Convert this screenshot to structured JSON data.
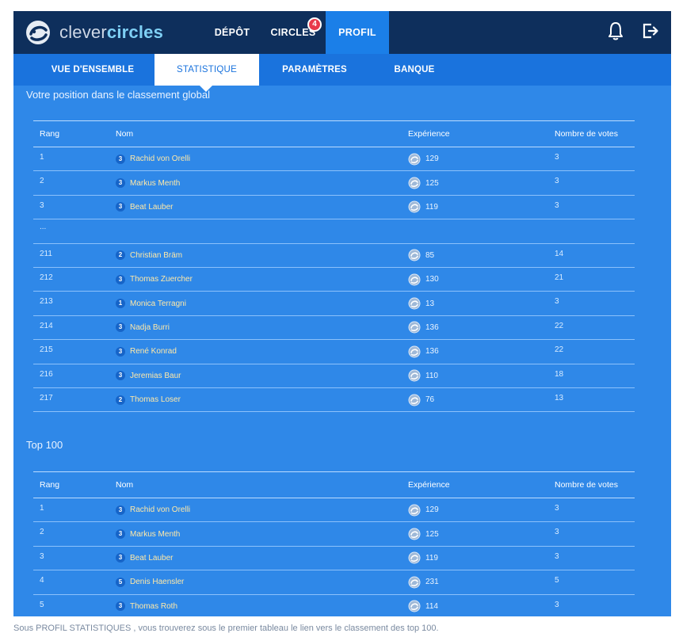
{
  "brand": {
    "light": "clever",
    "bold": "circles"
  },
  "nav": {
    "depot": "DÉPÔT",
    "circles": "CIRCLES",
    "circles_badge": "4",
    "profil": "PROFIL"
  },
  "subnav": {
    "vue": "VUE D'ENSEMBLE",
    "stat": "STATISTIQUE",
    "param": "PARAMÈTRES",
    "banque": "BANQUE"
  },
  "global": {
    "title": "Votre position dans le classement global",
    "headers": {
      "rank": "Rang",
      "name": "Nom",
      "exp": "Expérience",
      "votes": "Nombre de votes"
    },
    "rows_top": [
      {
        "rank": "1",
        "level": "3",
        "name": "Rachid von Orelli",
        "exp": "129",
        "votes": "3"
      },
      {
        "rank": "2",
        "level": "3",
        "name": "Markus Menth",
        "exp": "125",
        "votes": "3"
      },
      {
        "rank": "3",
        "level": "3",
        "name": "Beat Lauber",
        "exp": "119",
        "votes": "3"
      }
    ],
    "ellipsis": "...",
    "rows_bottom": [
      {
        "rank": "211",
        "level": "2",
        "name": "Christian Bräm",
        "exp": "85",
        "votes": "14"
      },
      {
        "rank": "212",
        "level": "3",
        "name": "Thomas Zuercher",
        "exp": "130",
        "votes": "21"
      },
      {
        "rank": "213",
        "level": "1",
        "name": "Monica Terragni",
        "exp": "13",
        "votes": "3"
      },
      {
        "rank": "214",
        "level": "3",
        "name": "Nadja Burri",
        "exp": "136",
        "votes": "22"
      },
      {
        "rank": "215",
        "level": "3",
        "name": "René Konrad",
        "exp": "136",
        "votes": "22"
      },
      {
        "rank": "216",
        "level": "3",
        "name": "Jeremias Baur",
        "exp": "110",
        "votes": "18"
      },
      {
        "rank": "217",
        "level": "2",
        "name": "Thomas Loser",
        "exp": "76",
        "votes": "13"
      }
    ]
  },
  "top100": {
    "title": "Top 100",
    "headers": {
      "rank": "Rang",
      "name": "Nom",
      "exp": "Expérience",
      "votes": "Nombre de votes"
    },
    "rows": [
      {
        "rank": "1",
        "level": "3",
        "name": "Rachid von Orelli",
        "exp": "129",
        "votes": "3"
      },
      {
        "rank": "2",
        "level": "3",
        "name": "Markus Menth",
        "exp": "125",
        "votes": "3"
      },
      {
        "rank": "3",
        "level": "3",
        "name": "Beat Lauber",
        "exp": "119",
        "votes": "3"
      },
      {
        "rank": "4",
        "level": "5",
        "name": "Denis Haensler",
        "exp": "231",
        "votes": "5"
      },
      {
        "rank": "5",
        "level": "3",
        "name": "Thomas Roth",
        "exp": "114",
        "votes": "3"
      }
    ]
  },
  "caption": "Sous PROFIL STATISTIQUES , vous trouverez sous le premier tableau le lien vers le classement des top 100.",
  "icons": {
    "logo": "clever-circles-logo-icon",
    "bell": "bell-icon",
    "logout": "logout-icon",
    "experience": "experience-icon",
    "level": "level-badge"
  },
  "colors": {
    "topbar": "#0e2f5c",
    "subnav": "#1a73dd",
    "content": "#2f88e8",
    "active_tab": "#1b7fe8",
    "badge": "#e8394b",
    "name_text": "#ffe9a8"
  }
}
